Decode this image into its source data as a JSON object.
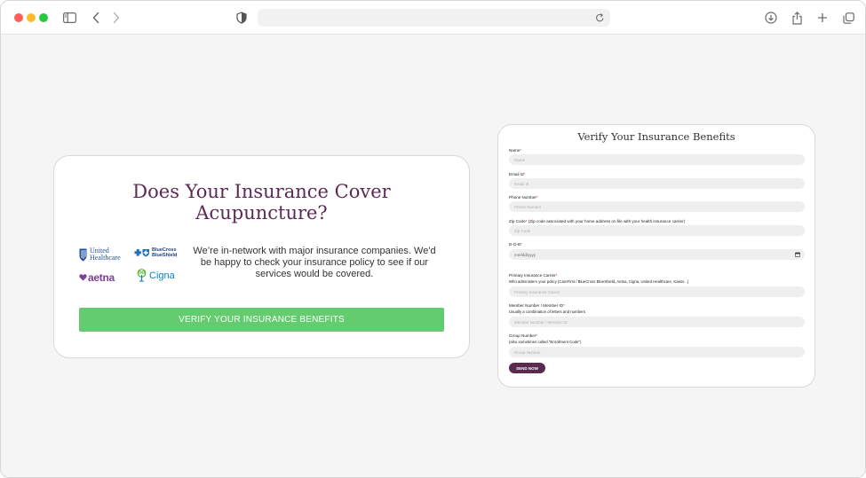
{
  "browser": {
    "icons": {
      "sidebar": "sidebar-icon",
      "back": "chevron-left-icon",
      "forward": "chevron-right-icon",
      "privacy": "shield-icon",
      "reload": "reload-icon",
      "download": "download-icon",
      "share": "share-icon",
      "new_tab": "plus-icon",
      "tabs": "tabs-overview-icon"
    },
    "url": ""
  },
  "promo": {
    "title": "Does Your Insurance Cover Acupuncture?",
    "text": "We’re in-network with major insurance companies. We'd be happy to check your insurance policy to see if our services would be covered.",
    "button_label": "VERIFY YOUR INSURANCE BENEFITS",
    "logos": {
      "uh_line1": "United",
      "uh_line2": "Healthcare",
      "bc_line1": "BlueCross",
      "bc_line2": "BlueShield",
      "aetna": "aetna",
      "cigna": "Cigna"
    },
    "colors": {
      "title": "#5b2a55",
      "button": "#62cc6e"
    }
  },
  "form": {
    "title": "Verify Your Insurance Benefits",
    "fields": {
      "name": {
        "label": "Name",
        "placeholder": "Name"
      },
      "email": {
        "label": "Email Id",
        "placeholder": "Email Id"
      },
      "phone": {
        "label": "Phone Number",
        "placeholder": "Phone Number"
      },
      "zip": {
        "label": "Zip Code",
        "sub": "(Zip code associated with your home address on file with your health insurance carrier)",
        "placeholder": "Zip Code"
      },
      "dob": {
        "label": "D-O-B",
        "placeholder": "mm/dd/yyyy"
      },
      "carrier": {
        "label": "Primary Insurance Carrier",
        "sub": "Who administers your policy (CareFirst / BlueCross BlueShield, Aetna, Cigna, United Healthcare, Kaiser...)",
        "placeholder": "Primary Insurance Carrier"
      },
      "member": {
        "label": "Member Number / Member ID",
        "sub": "Usually a combination of letters and numbers",
        "placeholder": "Member Number / Member ID"
      },
      "group": {
        "label": "Group Number",
        "sub": "(also sometimes called \"Enrollment Code\")",
        "placeholder": "Group Number"
      }
    },
    "required_mark": "*",
    "submit_label": "SEND NOW",
    "colors": {
      "submit": "#5b2a4f",
      "input_bg": "#efefef"
    }
  }
}
